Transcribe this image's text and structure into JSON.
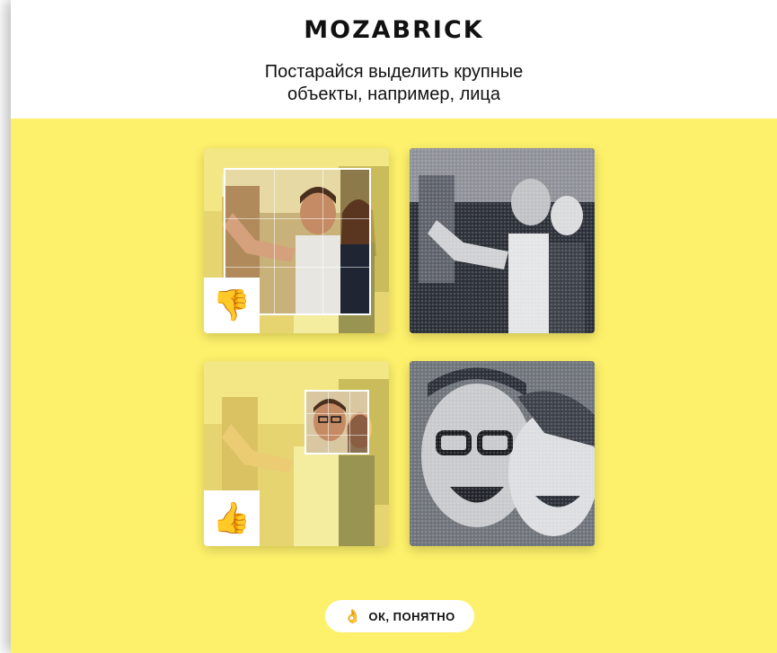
{
  "header": {
    "logo": "MOZABRICK",
    "subtitle_line1": "Постарайся выделить крупные",
    "subtitle_line2": "объекты, например, лица"
  },
  "examples": [
    {
      "verdict": "bad",
      "badge_emoji": "👎",
      "badge_icon": "thumbs-down-icon"
    },
    {
      "verdict": "good",
      "badge_emoji": "👍",
      "badge_icon": "thumbs-up-icon"
    }
  ],
  "confirm_button": {
    "icon": "ok-hand-icon",
    "icon_glyph": "👌",
    "label": "ОК, ПОНЯТНО"
  },
  "colors": {
    "panel_bg": "#fdf06a",
    "header_bg": "#ffffff",
    "button_bg": "#ffffff"
  }
}
